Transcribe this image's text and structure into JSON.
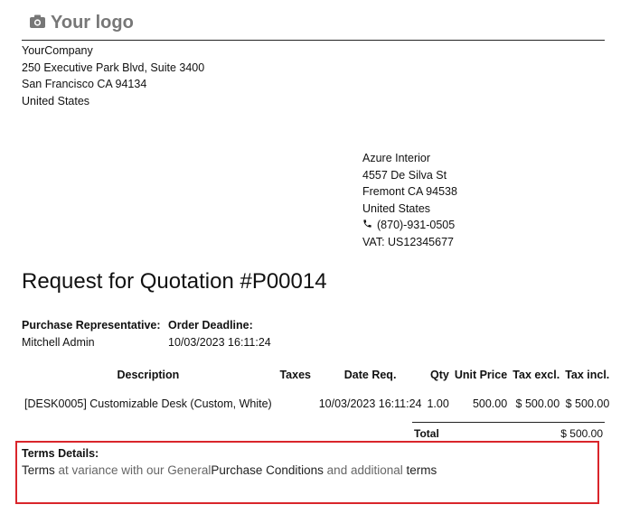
{
  "logo": {
    "text": "Your logo",
    "icon": "camera-icon"
  },
  "company": {
    "name": "YourCompany",
    "street": "250 Executive Park Blvd, Suite 3400",
    "city": "San Francisco CA 94134",
    "country": "United States"
  },
  "partner": {
    "name": "Azure Interior",
    "street": "4557 De Silva St",
    "city": "Fremont CA 94538",
    "country": "United States",
    "phone": "(870)-931-0505",
    "vat": "VAT: US12345677"
  },
  "title": "Request for Quotation #P00014",
  "info": {
    "rep_label": "Purchase Representative:",
    "rep_value": "Mitchell Admin",
    "deadline_label": "Order Deadline:",
    "deadline_value": "10/03/2023 16:11:24"
  },
  "table": {
    "headers": {
      "description": "Description",
      "taxes": "Taxes",
      "date_req": "Date Req.",
      "qty": "Qty",
      "unit_price": "Unit Price",
      "tax_excl": "Tax excl.",
      "tax_incl": "Tax incl."
    },
    "rows": [
      {
        "description": "[DESK0005] Customizable Desk (Custom, White)",
        "taxes": "",
        "date_req": "10/03/2023 16:11:24",
        "qty": "1.00",
        "unit_price": "500.00",
        "tax_excl": "$ 500.00",
        "tax_incl": "$ 500.00"
      }
    ]
  },
  "total": {
    "label": "Total",
    "value": "$ 500.00"
  },
  "terms": {
    "title": "Terms Details:",
    "part1": "Terms",
    "part2": " at variance with our General",
    "part3": "Purchase Conditions",
    "part4": " and additional ",
    "part5": "terms"
  }
}
